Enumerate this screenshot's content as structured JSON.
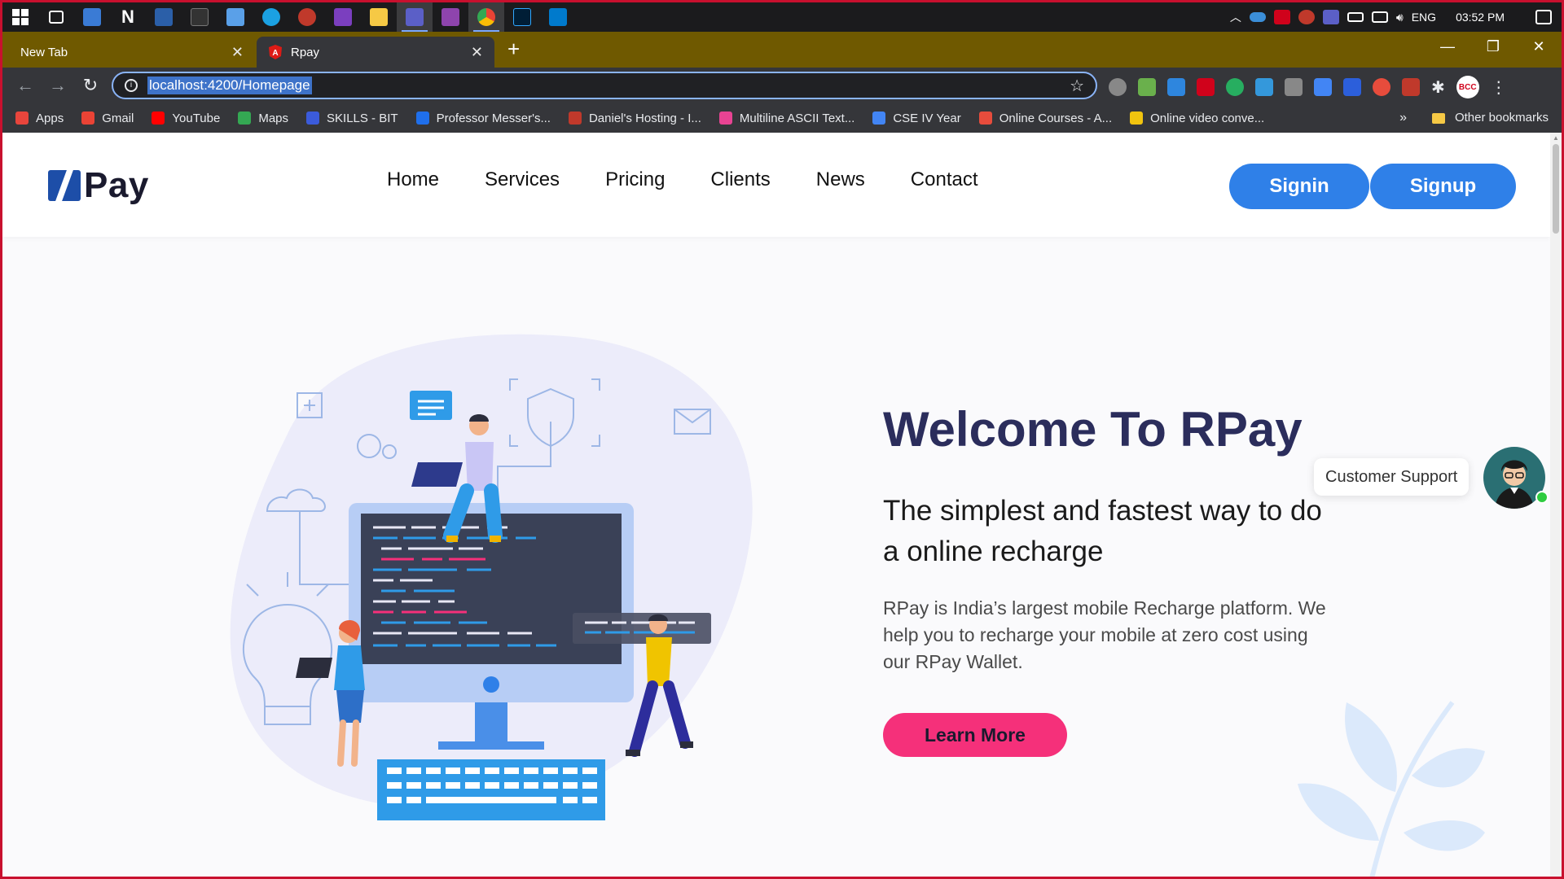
{
  "taskbar": {
    "icons": [
      "windows-icon",
      "task-view-icon",
      "app-icon",
      "notion-icon",
      "app-icon",
      "app-icon",
      "photos-icon",
      "edge-icon",
      "app-icon",
      "visual-studio-icon",
      "file-explorer-icon",
      "teams-icon",
      "visual-studio-icon",
      "chrome-icon",
      "photoshop-icon",
      "vscode-icon"
    ],
    "language": "ENG",
    "time": "03:52 PM"
  },
  "browser": {
    "tabs": [
      {
        "title": "New Tab"
      },
      {
        "title": "Rpay"
      }
    ],
    "url": "localhost:4200/Homepage",
    "bookmarks": [
      {
        "label": "Apps",
        "color": "#e8453c"
      },
      {
        "label": "Gmail",
        "color": "#ea4335"
      },
      {
        "label": "YouTube",
        "color": "#ff0000"
      },
      {
        "label": "Maps",
        "color": "#34a853"
      },
      {
        "label": "SKILLS - BIT",
        "color": "#3b5bdb"
      },
      {
        "label": "Professor Messer's...",
        "color": "#1f6feb"
      },
      {
        "label": "Daniel's Hosting - I...",
        "color": "#c0392b"
      },
      {
        "label": "Multiline ASCII Text...",
        "color": "#e84393"
      },
      {
        "label": "CSE IV Year",
        "color": "#4285f4"
      },
      {
        "label": "Online Courses - A...",
        "color": "#e74c3c"
      },
      {
        "label": "Online video conve...",
        "color": "#f1c40f"
      }
    ],
    "bookmarks_more": "»",
    "other_bookmarks": "Other bookmarks"
  },
  "site": {
    "logo": "Pay",
    "nav": [
      "Home",
      "Services",
      "Pricing",
      "Clients",
      "News",
      "Contact"
    ],
    "signin": "Signin",
    "signup": "Signup",
    "hero": {
      "title": "Welcome To RPay",
      "subtitle": "The simplest and fastest way to do a online recharge",
      "description": "RPay is India’s largest mobile Recharge platform. We help you to recharge your mobile at zero cost using our RPay Wallet.",
      "cta": "Learn More"
    },
    "support": "Customer Support"
  },
  "colors": {
    "primary": "#2f80e8",
    "accent": "#f5307a",
    "heading": "#2b2d5c",
    "tab_strip": "#6f5900"
  }
}
